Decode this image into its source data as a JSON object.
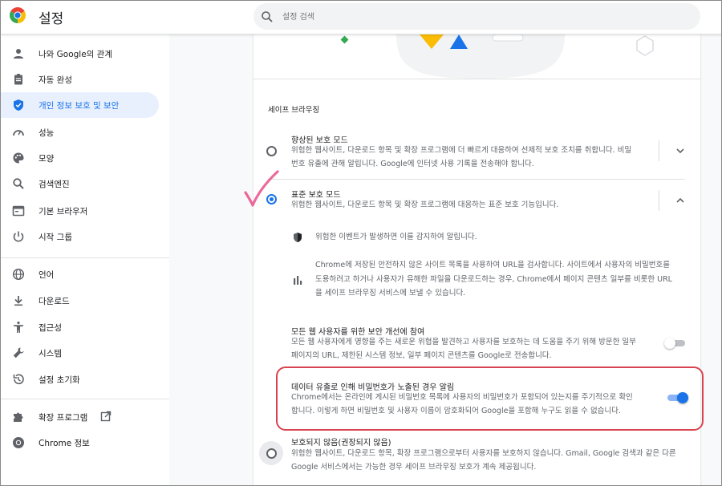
{
  "header": {
    "title": "설정",
    "search_placeholder": "설정 검색"
  },
  "sidebar": {
    "items": [
      {
        "label": "나와 Google의 관계",
        "icon": "person-icon"
      },
      {
        "label": "자동 완성",
        "icon": "clipboard-icon"
      },
      {
        "label": "개인 정보 보호 및 보안",
        "icon": "shield-icon",
        "active": true
      },
      {
        "label": "성능",
        "icon": "gauge-icon"
      },
      {
        "label": "모양",
        "icon": "palette-icon"
      },
      {
        "label": "검색엔진",
        "icon": "search-icon"
      },
      {
        "label": "기본 브라우저",
        "icon": "browser-icon"
      },
      {
        "label": "시작 그룹",
        "icon": "power-icon"
      },
      {
        "label": "언어",
        "icon": "globe-icon"
      },
      {
        "label": "다운로드",
        "icon": "download-icon"
      },
      {
        "label": "접근성",
        "icon": "accessibility-icon"
      },
      {
        "label": "시스템",
        "icon": "wrench-icon"
      },
      {
        "label": "설정 초기화",
        "icon": "reset-icon"
      },
      {
        "label": "확장 프로그램",
        "icon": "puzzle-icon"
      },
      {
        "label": "Chrome 정보",
        "icon": "chrome-icon"
      }
    ]
  },
  "main": {
    "section_title": "세이프 브라우징",
    "enhanced": {
      "title": "향상된 보호 모드",
      "desc1": "위험한 웹사이트, 다운로드 항목 및 확장 프로그램에 더 빠르게 대응하여 선제적 보호 조치를 취합니다. 비밀",
      "desc2": "번호 유출에 관해 알립니다. Google에 인터넷 사용 기록을 전송해야 합니다."
    },
    "standard": {
      "title": "표준 보호 모드",
      "desc": "위험한 웹사이트, 다운로드 항목 및 확장 프로그램에 대응하는 표준 보호 기능입니다.",
      "info1": "위험한 이벤트가 발생하면 이를 감지하여 알립니다.",
      "info2_line1": "Chrome에 저장된 안전하지 않은 사이트 목록을 사용하여 URL을 검사합니다. 사이트에서 사용자의 비밀번호를",
      "info2_line2": "도용하려고 하거나 사용자가 유해한 파일을 다운로드하는 경우, Chrome에서 페이지 콘텐츠 일부를 비롯한 URL",
      "info2_line3": "을 세이프 브라우징 서비스에 보낼 수 있습니다."
    },
    "improve": {
      "title": "모든 웹 사용자를 위한 보안 개선에 참여",
      "desc1": "모든 웹 사용자에게 영향을 주는 새로운 위협을 발견하고 사용자를 보호하는 데 도움을 주기 위해 방문한 일부",
      "desc2": "페이지의 URL, 제한된 시스템 정보, 일부 페이지 콘텐츠를 Google로 전송합니다.",
      "enabled": false
    },
    "leak": {
      "title": "데이터 유출로 인해 비밀번호가 노출된 경우 알림",
      "desc1": "Chrome에서는 온라인에 게시된 비밀번호 목록에 사용자의 비밀번호가 포함되어 있는지를 주기적으로 확인",
      "desc2": "합니다. 이렇게 하면 비밀번호 및 사용자 이름이 암호화되어 Google을 포함해 누구도 읽을 수 없습니다.",
      "enabled": true
    },
    "none": {
      "title": "보호되지 않음(권장되지 않음)",
      "desc1": "위험한 웹사이트, 다운로드 항목, 확장 프로그램으로부터 사용자를 보호하지 않습니다. Gmail, Google 검색과 같은 다른",
      "desc2": "Google 서비스에서는 가능한 경우 세이프 브라우징 보호가 계속 제공됩니다."
    }
  },
  "colors": {
    "accent": "#1a73e8",
    "active_bg": "#e8f0fe",
    "highlight": "#d9434f",
    "checkmark": "#e8508a"
  }
}
